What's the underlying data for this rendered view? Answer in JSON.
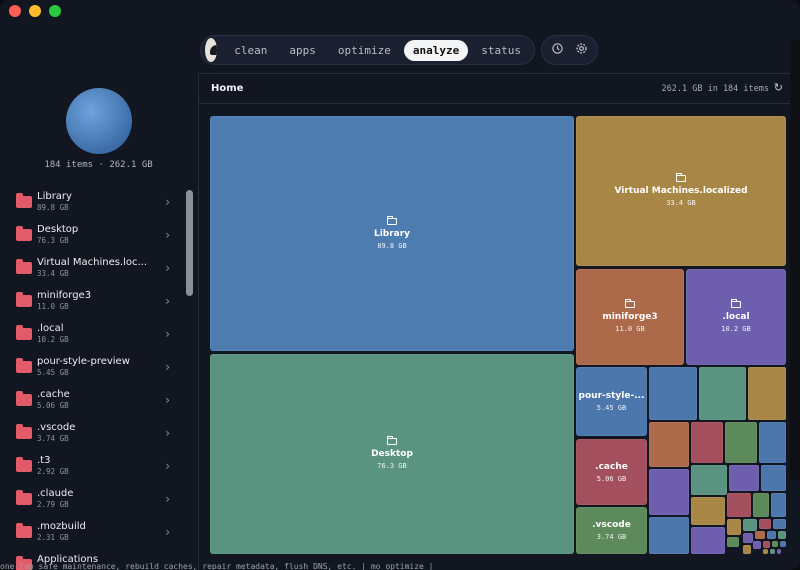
{
  "window": {
    "traffic_lights": {
      "close": "#ff5f57",
      "minimize": "#febc2e",
      "zoom": "#28c840"
    }
  },
  "nav": {
    "logo": "cloud-logo-icon",
    "tabs": [
      {
        "label": "clean",
        "active": false
      },
      {
        "label": "apps",
        "active": false
      },
      {
        "label": "optimize",
        "active": false
      },
      {
        "label": "analyze",
        "active": true
      },
      {
        "label": "status",
        "active": false
      }
    ],
    "history_icon": "history-icon",
    "settings_icon": "gear-icon"
  },
  "sidebar": {
    "summary": "184 items · 262.1 GB",
    "items": [
      {
        "name": "Library",
        "size": "89.8 GB"
      },
      {
        "name": "Desktop",
        "size": "76.3 GB"
      },
      {
        "name": "Virtual Machines.loc...",
        "size": "33.4 GB"
      },
      {
        "name": "miniforge3",
        "size": "11.0 GB"
      },
      {
        "name": ".local",
        "size": "10.2 GB"
      },
      {
        "name": "pour-style-preview",
        "size": "5.45 GB"
      },
      {
        "name": ".cache",
        "size": "5.06 GB"
      },
      {
        "name": ".vscode",
        "size": "3.74 GB"
      },
      {
        "name": ".t3",
        "size": "2.92 GB"
      },
      {
        "name": ".claude",
        "size": "2.79 GB"
      },
      {
        "name": ".mozbuild",
        "size": "2.31 GB"
      },
      {
        "name": "Applications",
        "size": ""
      }
    ]
  },
  "main": {
    "title": "Home",
    "stats": "262.1 GB in 184 items",
    "tiles": [
      {
        "name": "Library",
        "size": "89.8 GB",
        "color": "#4d7cb0"
      },
      {
        "name": "Desktop",
        "size": "76.3 GB",
        "color": "#5a9380"
      },
      {
        "name": "Virtual Machines.localized",
        "size": "33.4 GB",
        "color": "#a88746"
      },
      {
        "name": "miniforge3",
        "size": "11.0 GB",
        "color": "#ad6a4b"
      },
      {
        "name": ".local",
        "size": "10.2 GB",
        "color": "#6d5fae"
      },
      {
        "name": "pour-style-...",
        "size": "5.45 GB",
        "color": "#4c77ac"
      },
      {
        "name": ".cache",
        "size": "5.06 GB",
        "color": "#a34f5d"
      },
      {
        "name": ".vscode",
        "size": "3.74 GB",
        "color": "#5c8a5a"
      }
    ]
  },
  "terminal": {
    "line": "one-tap safe maintenance, rebuild caches, repair metadata, flush DNS, etc.  |  mo optimize  |"
  }
}
